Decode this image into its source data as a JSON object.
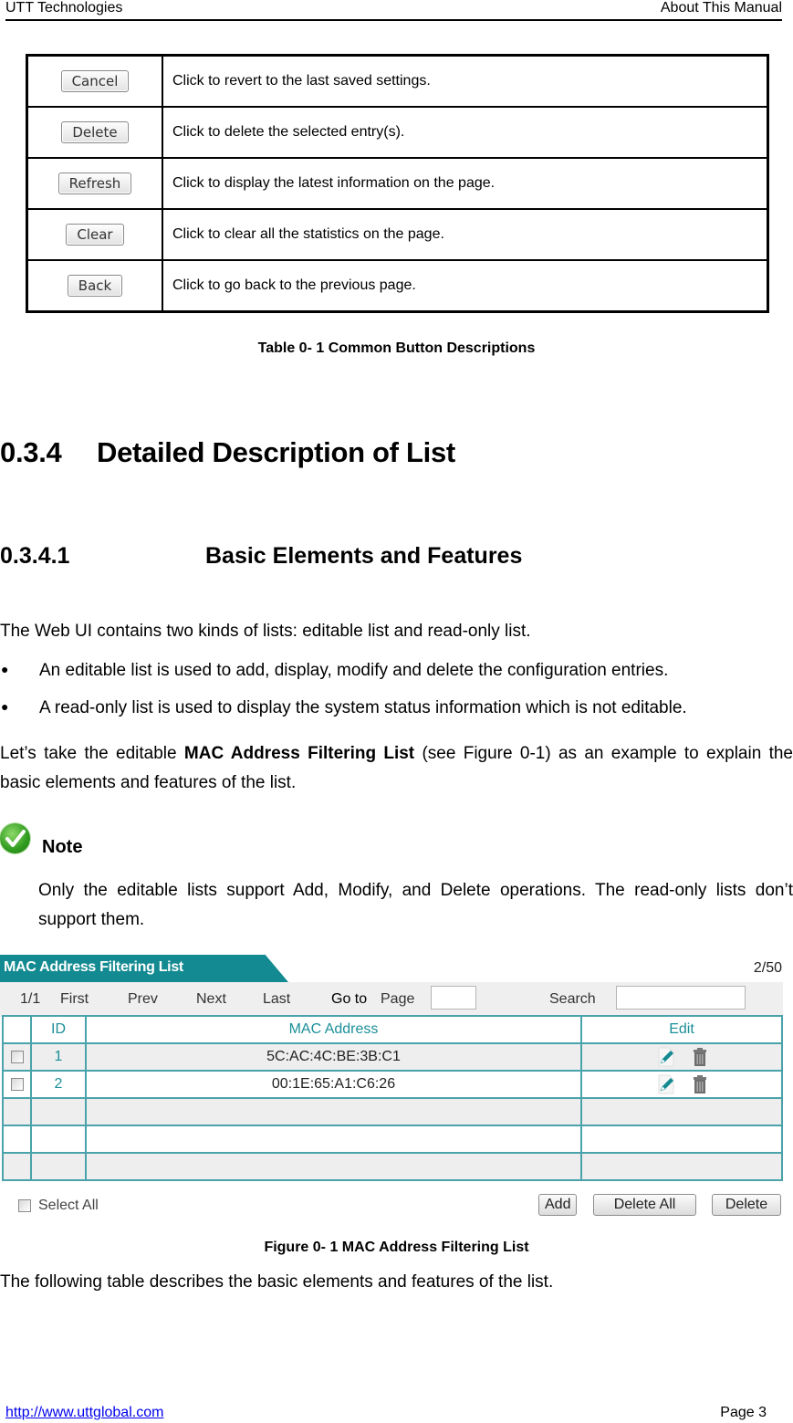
{
  "header": {
    "left": "UTT Technologies",
    "right": "About This Manual"
  },
  "button_table": {
    "rows": [
      {
        "button": "Cancel",
        "description": "Click to revert to the last saved settings."
      },
      {
        "button": "Delete",
        "description": "Click to delete the selected entry(s)."
      },
      {
        "button": "Refresh",
        "description": "Click to display the latest information on the page."
      },
      {
        "button": "Clear",
        "description": "Click to clear all the statistics on the page."
      },
      {
        "button": "Back",
        "description": "Click to go back to the previous page."
      }
    ],
    "caption": "Table 0- 1 Common Button Descriptions"
  },
  "section": {
    "number": "0.3.4",
    "title": "Detailed Description of List"
  },
  "subsection": {
    "number": "0.3.4.1",
    "title": "Basic Elements and Features"
  },
  "body": {
    "intro": "The Web UI contains two kinds of lists: editable list and read-only list.",
    "bullets": [
      "An editable list is used to add, display, modify and delete the configuration entries.",
      "A read-only list is used to display the system status information which is not editable."
    ],
    "example_pre": "Let’s take the editable ",
    "example_bold": "MAC Address Filtering List",
    "example_post": " (see Figure 0-1) as an example to explain the basic elements and features of the list."
  },
  "note": {
    "label": "Note",
    "text": "Only the editable lists support Add, Modify, and Delete operations. The read-only lists don’t support them."
  },
  "figure": {
    "title": "MAC Address Filtering List",
    "count": "2/50",
    "nav": {
      "page": "1/1",
      "first": "First",
      "prev": "Prev",
      "next": "Next",
      "last": "Last",
      "goto": "Go to",
      "page_label": "Page",
      "search": "Search"
    },
    "page_input_value": "",
    "search_input_value": "",
    "columns": [
      "",
      "ID",
      "MAC Address",
      "Edit"
    ],
    "rows": [
      {
        "id": "1",
        "mac": "5C:AC:4C:BE:3B:C1"
      },
      {
        "id": "2",
        "mac": "00:1E:65:A1:C6:26"
      }
    ],
    "empty_rows": 3,
    "select_all": "Select All",
    "buttons": {
      "add": "Add",
      "delete_all": "Delete All",
      "delete": "Delete"
    },
    "caption": "Figure 0- 1 MAC Address Filtering List",
    "colors": {
      "teal": "#138a91",
      "grid": "#4aa3aa"
    }
  },
  "closing": "The following table describes the basic elements and features of the list.",
  "footer": {
    "url": "http://www.uttglobal.com",
    "page": "Page 3"
  }
}
